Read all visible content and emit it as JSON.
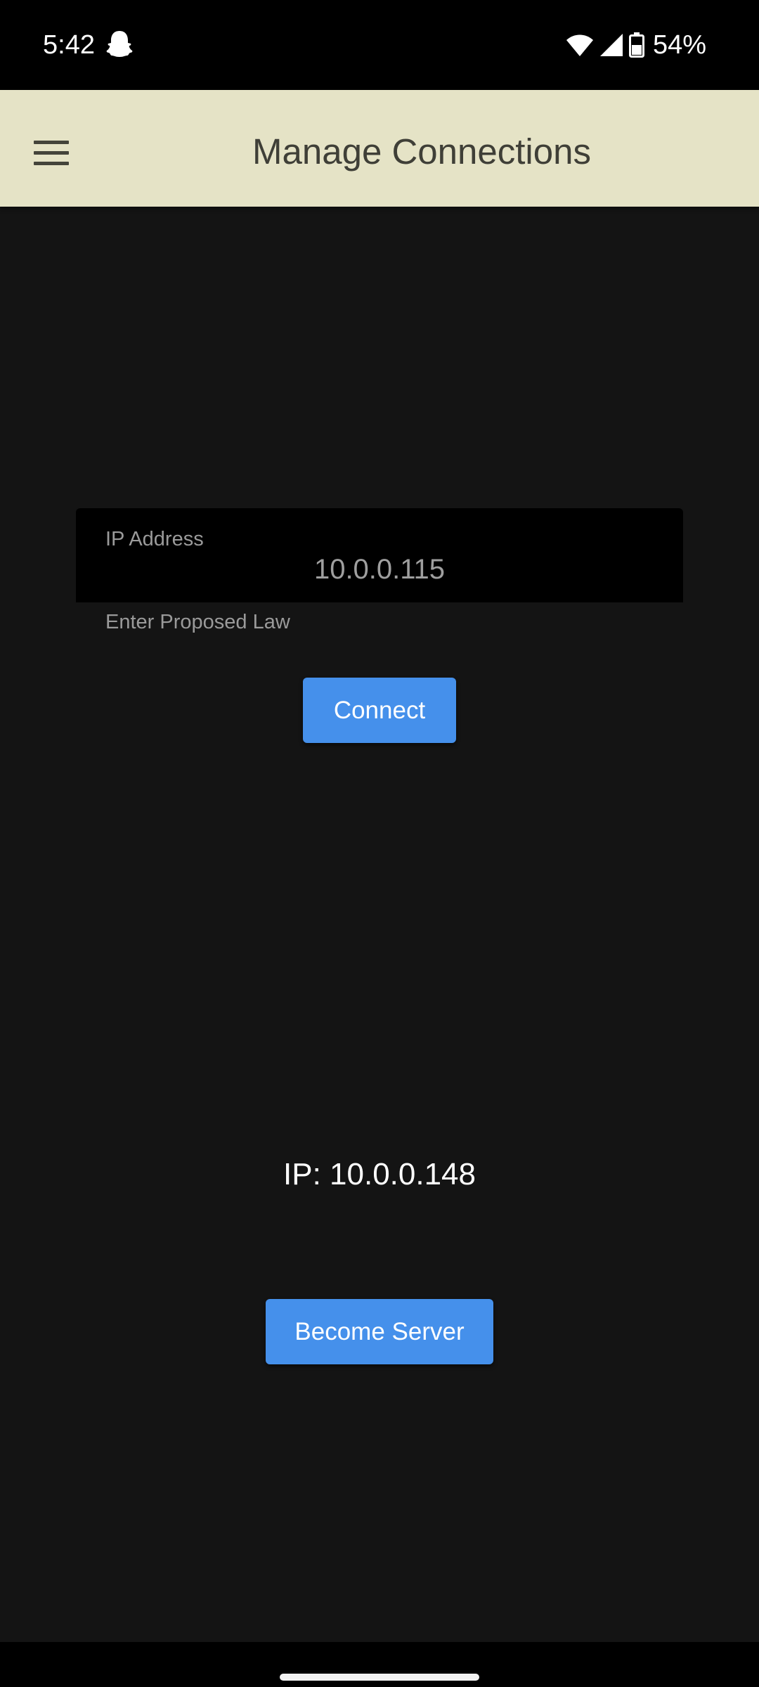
{
  "status_bar": {
    "time": "5:42",
    "notification_icons": [
      "snapchat-ghost-icon"
    ],
    "status_icons": [
      "wifi-icon",
      "signal-icon",
      "battery-icon"
    ],
    "battery_percent": "54%"
  },
  "app_bar": {
    "title": "Manage Connections",
    "menu_icon": "hamburger-menu-icon"
  },
  "connect_form": {
    "ip_label": "IP Address",
    "ip_value": "10.0.0.115",
    "helper_text": "Enter Proposed Law",
    "connect_label": "Connect"
  },
  "server": {
    "ip_text": "IP: 10.0.0.148",
    "become_server_label": "Become Server"
  },
  "colors": {
    "app_bar": "#e5e3c6",
    "background": "#141414",
    "button": "#4590eb",
    "field": "#000000"
  }
}
